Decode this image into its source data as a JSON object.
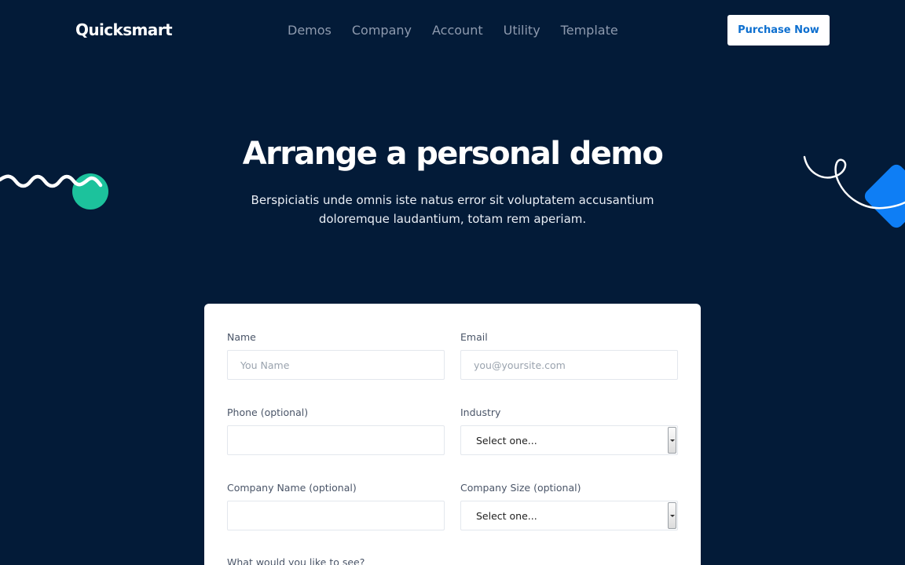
{
  "header": {
    "logo": "Quicksmart",
    "nav": [
      "Demos",
      "Company",
      "Account",
      "Utility",
      "Template"
    ],
    "cta_label": "Purchase Now"
  },
  "hero": {
    "title": "Arrange a personal demo",
    "subtitle": "Berspiciatis unde omnis iste natus error sit voluptatem accusantium doloremque laudantium, totam rem aperiam."
  },
  "form": {
    "name": {
      "label": "Name",
      "placeholder": "You Name",
      "value": ""
    },
    "email": {
      "label": "Email",
      "placeholder": "you@yoursite.com",
      "value": ""
    },
    "phone": {
      "label": "Phone (optional)",
      "value": ""
    },
    "industry": {
      "label": "Industry",
      "selected": "Select one..."
    },
    "company_name": {
      "label": "Company Name (optional)",
      "value": ""
    },
    "company_size": {
      "label": "Company Size (optional)",
      "selected": "Select one..."
    },
    "interests_label": "What would you like to see?"
  },
  "colors": {
    "background": "#031b38",
    "accent_blue": "#0d6fcf",
    "deco_green": "#1cc29c",
    "deco_blue": "#0e7ef5"
  },
  "icons": {
    "wave": "wave-decoration",
    "loop": "loop-decoration"
  }
}
